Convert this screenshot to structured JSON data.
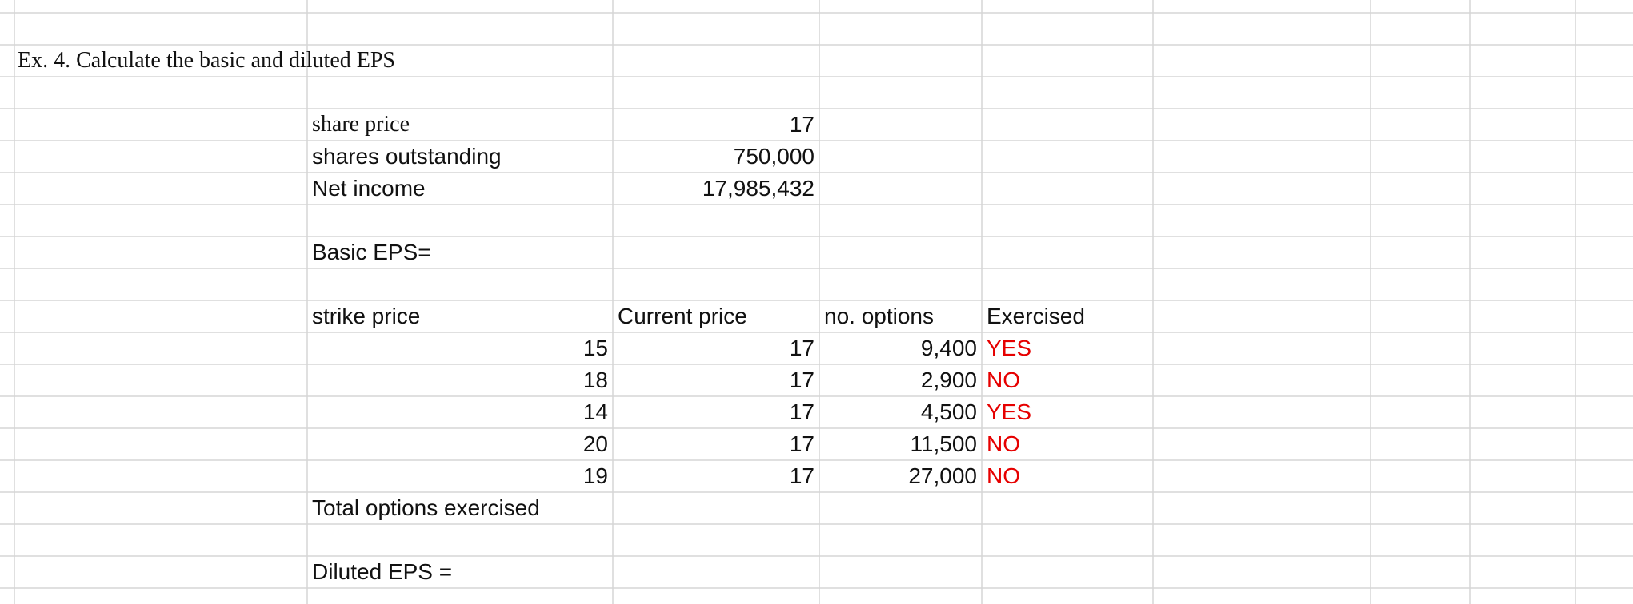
{
  "sheet": {
    "title": "Ex. 4. Calculate the basic and diluted EPS",
    "share_price_label": "share price",
    "share_price_value": "17",
    "shares_outstanding_label": "shares outstanding",
    "shares_outstanding_value": "750,000",
    "net_income_label": "Net income",
    "net_income_value": "17,985,432",
    "basic_eps_label": "Basic EPS=",
    "headers": {
      "strike_price": "strike price",
      "current_price": "Current price",
      "no_options": "no. options",
      "exercised": "Exercised"
    },
    "rows": [
      {
        "strike": "15",
        "current": "17",
        "options": "9,400",
        "exercised": "YES"
      },
      {
        "strike": "18",
        "current": "17",
        "options": "2,900",
        "exercised": "NO"
      },
      {
        "strike": "14",
        "current": "17",
        "options": "4,500",
        "exercised": "YES"
      },
      {
        "strike": "20",
        "current": "17",
        "options": "11,500",
        "exercised": "NO"
      },
      {
        "strike": "19",
        "current": "17",
        "options": "27,000",
        "exercised": "NO"
      }
    ],
    "total_options_label": "Total options exercised",
    "diluted_eps_label": "Diluted EPS ="
  },
  "colors": {
    "gridline": "#d6d6d6",
    "flag_text": "#e60000",
    "text": "#111111"
  }
}
